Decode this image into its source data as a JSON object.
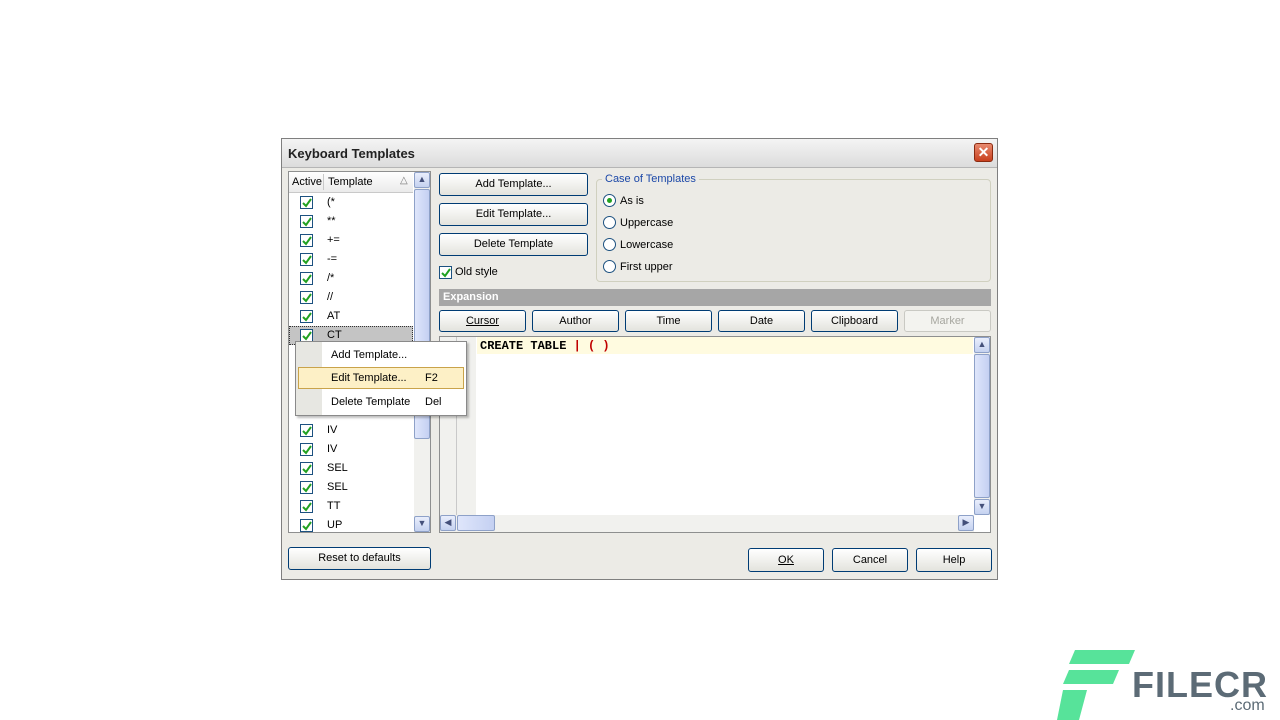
{
  "window": {
    "title": "Keyboard Templates",
    "close_symbol": "✕"
  },
  "template_list": {
    "col_active": "Active",
    "col_template": "Template",
    "sort_glyph": "△",
    "rows": [
      {
        "label": "(*",
        "checked": true
      },
      {
        "label": "**",
        "checked": true
      },
      {
        "label": "+=",
        "checked": true
      },
      {
        "label": "-=",
        "checked": true
      },
      {
        "label": "/*",
        "checked": true
      },
      {
        "label": "//",
        "checked": true
      },
      {
        "label": "AT",
        "checked": true
      },
      {
        "label": "CT",
        "checked": true,
        "selected": true
      },
      {
        "label": "IV",
        "checked": true
      },
      {
        "label": "IV",
        "checked": true
      },
      {
        "label": "SEL",
        "checked": true
      },
      {
        "label": "SEL",
        "checked": true
      },
      {
        "label": "TT",
        "checked": true
      },
      {
        "label": "UP",
        "checked": true
      }
    ]
  },
  "buttons": {
    "add_template": "Add Template...",
    "edit_template": "Edit Template...",
    "delete_template": "Delete Template",
    "reset_defaults": "Reset to defaults",
    "ok": "OK",
    "cancel": "Cancel",
    "help": "Help"
  },
  "old_style": {
    "label": "Old style",
    "checked": true
  },
  "case_group": {
    "title": "Case of Templates",
    "options": [
      {
        "label": "As is",
        "selected": true
      },
      {
        "label": "Uppercase",
        "selected": false
      },
      {
        "label": "Lowercase",
        "selected": false
      },
      {
        "label": "First upper",
        "selected": false
      }
    ]
  },
  "expansion": {
    "title": "Expansion",
    "buttons": {
      "cursor": "Cursor",
      "author": "Author",
      "time": "Time",
      "date": "Date",
      "clipboard": "Clipboard",
      "marker": "Marker"
    },
    "code_before": "CREATE TABLE ",
    "code_cursor": "|",
    "code_mid": " ",
    "code_parens": "( )"
  },
  "context_menu": {
    "items": [
      {
        "label": "Add Template...",
        "shortcut": ""
      },
      {
        "label": "Edit Template...",
        "shortcut": "F2"
      },
      {
        "label": "Delete Template",
        "shortcut": "Del"
      }
    ]
  },
  "watermark": {
    "text": "FILECR",
    "suffix": ".com"
  },
  "colors": {
    "accent": "#1c48a8",
    "watermark_green": "#57e39a",
    "code_red": "#c00000"
  }
}
